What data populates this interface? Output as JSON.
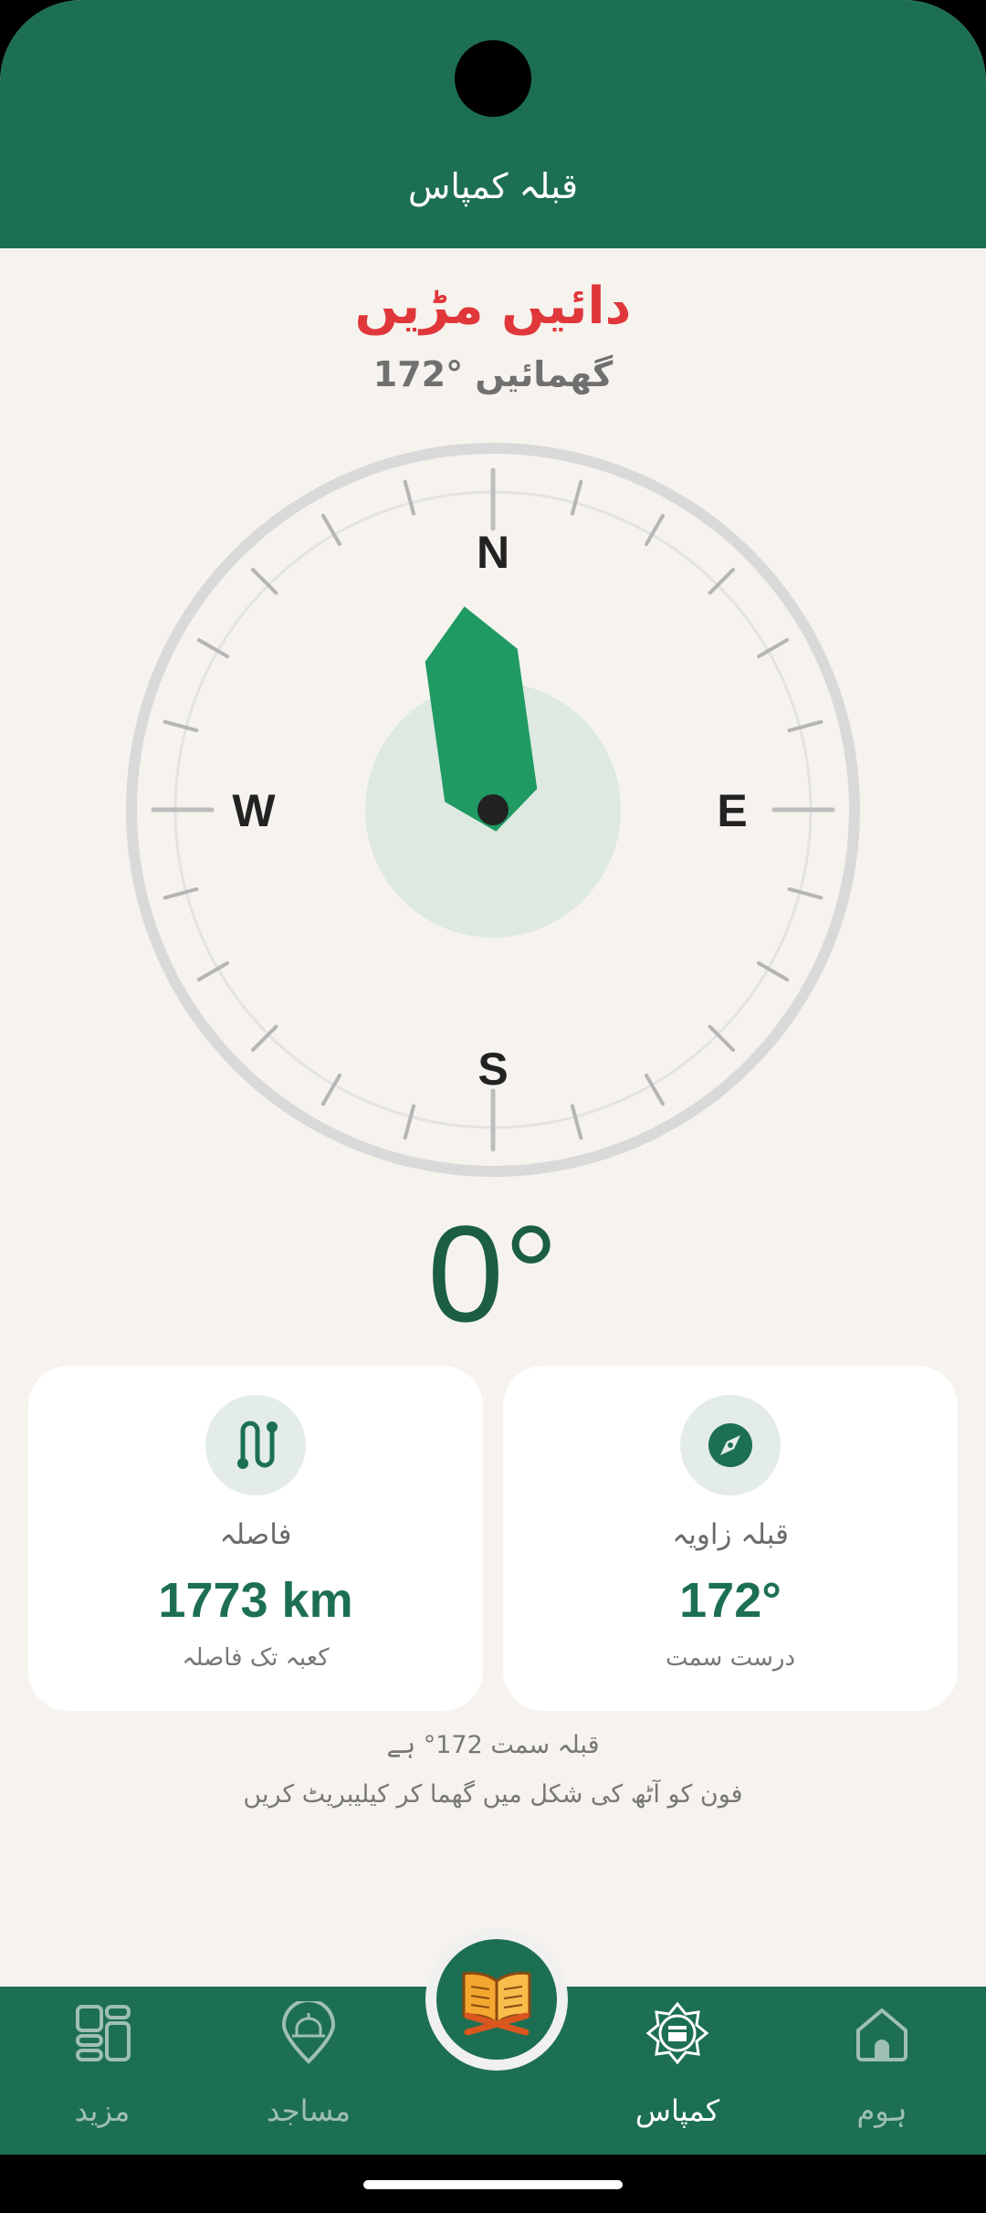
{
  "header": {
    "title": "قبلہ کمپاس"
  },
  "direction": {
    "instruction": "دائیں مڑیں",
    "rotate_text": "172° گھمائیں"
  },
  "compass": {
    "labels": {
      "north": "N",
      "east": "E",
      "south": "S",
      "west": "W"
    },
    "heading_degrees": 0,
    "needle_bearing_degrees": 172,
    "heading_text": "0°"
  },
  "cards": {
    "distance": {
      "label": "فاصلہ",
      "value": "1773 km",
      "caption": "کعبہ تک فاصلہ",
      "icon": "route-icon"
    },
    "qibla_angle": {
      "label": "قبلہ زاویہ",
      "value": "172°",
      "caption": "درست سمت",
      "icon": "compass-icon"
    }
  },
  "notes": {
    "direction": "قبلہ سمت 172° ہے",
    "calibrate": "فون کو آٹھ کی شکل میں گھما کر کیلیبریٹ کریں"
  },
  "nav": {
    "items": [
      {
        "label": "مزید",
        "icon": "grid-icon",
        "active": false
      },
      {
        "label": "مساجد",
        "icon": "mosque-pin-icon",
        "active": false
      },
      {
        "label": "کمپاس",
        "icon": "kaaba-compass-icon",
        "active": true
      },
      {
        "label": "ہوم",
        "icon": "home-icon",
        "active": false
      }
    ],
    "center_icon": "quran-icon"
  },
  "colors": {
    "primary": "#1d6f54",
    "accent_red": "#e0373a",
    "needle_green": "#1f9a62",
    "background": "#f6f3ee"
  }
}
